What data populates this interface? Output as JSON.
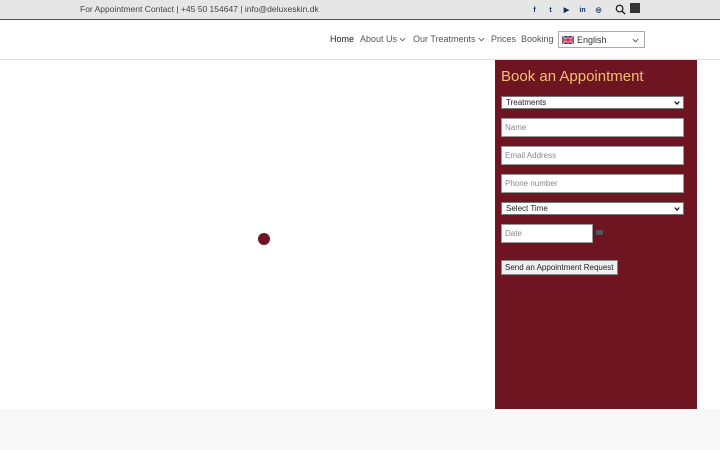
{
  "topbar": {
    "contact": "For Appointment Contact | +45 50 154647 | info@deluxeskin.dk",
    "socials": [
      {
        "icon": "facebook-icon",
        "glyph": "f"
      },
      {
        "icon": "twitter-icon",
        "glyph": "t"
      },
      {
        "icon": "youtube-icon",
        "glyph": "▶"
      },
      {
        "icon": "linkedin-icon",
        "glyph": "in"
      },
      {
        "icon": "instagram-icon",
        "glyph": "◎"
      }
    ]
  },
  "nav": {
    "home": "Home",
    "about": "About Us",
    "treatments": "Our Treatments",
    "prices": "Prices",
    "booking": "Booking"
  },
  "language": {
    "selected": "English"
  },
  "booking": {
    "title": "Book an Appointment",
    "treatments_select": "Treatments",
    "name_placeholder": "Name",
    "email_placeholder": "Email Address",
    "phone_placeholder": "Phone number",
    "time_select": "Select Time",
    "date_placeholder": "Date",
    "submit_label": "Send an Appointment Request"
  },
  "colors": {
    "brand": "#6f1421",
    "title": "#f0c070",
    "social": "#0d2f63"
  }
}
